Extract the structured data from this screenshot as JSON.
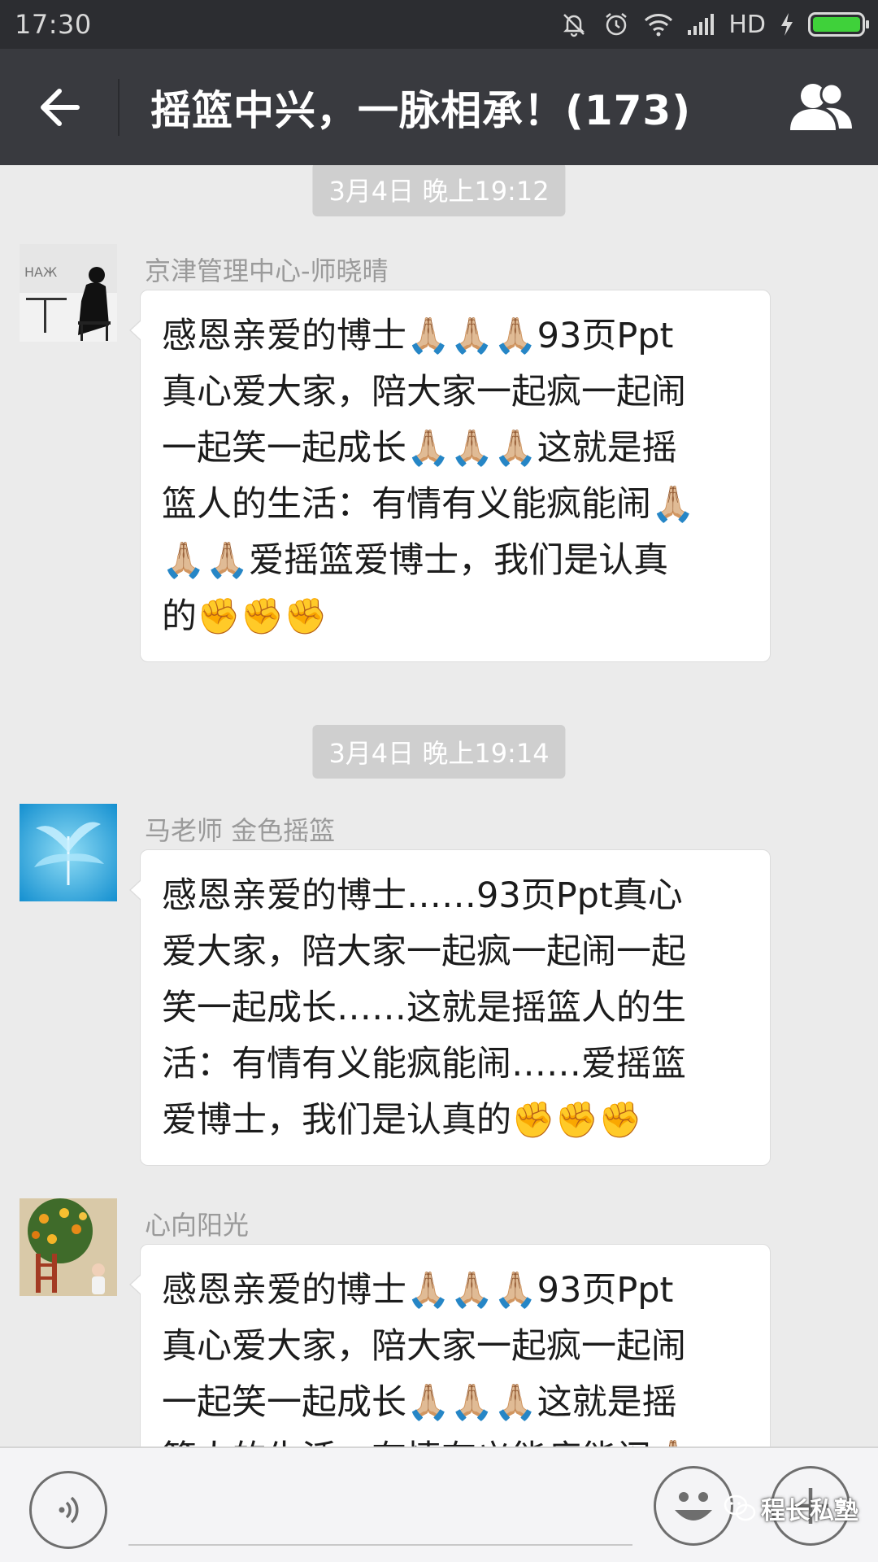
{
  "status_bar": {
    "time": "17:30",
    "network": "HD",
    "icons": [
      "mute-icon",
      "alarm-icon",
      "wifi-icon",
      "signal-icon",
      "charging-icon",
      "battery-icon"
    ],
    "battery_level": 1.0
  },
  "header": {
    "title": "摇篮中兴，一脉相承！(173)",
    "back_icon": "back-arrow-icon",
    "members_icon": "group-members-icon"
  },
  "messages": [
    {
      "timestamp": "3月4日 晚上19:12",
      "sender": "京津管理中心-师晓晴",
      "lines": [
        "感恩亲爱的博士🙏🏼🙏🏼🙏🏼93页Ppt",
        "真心爱大家，陪大家一起疯一起闹",
        "一起笑一起成长🙏🏼🙏🏼🙏🏼这就是摇",
        "篮人的生活：有情有义能疯能闹🙏🏼",
        "🙏🏼🙏🏼爱摇篮爱博士，我们是认真",
        "的✊✊✊"
      ]
    },
    {
      "timestamp": "3月4日 晚上19:14",
      "sender": "马老师  金色摇篮",
      "lines": [
        "感恩亲爱的博士……93页Ppt真心",
        "爱大家，陪大家一起疯一起闹一起",
        "笑一起成长……这就是摇篮人的生",
        "活：有情有义能疯能闹……爱摇篮",
        "爱博士，我们是认真的✊✊✊"
      ]
    },
    {
      "timestamp": "",
      "sender": "心向阳光",
      "lines": [
        "感恩亲爱的博士🙏🏼🙏🏼🙏🏼93页Ppt",
        "真心爱大家，陪大家一起疯一起闹",
        "一起笑一起成长🙏🏼🙏🏼🙏🏼这就是摇",
        "篮人的生活：有情有义能疯能闹🙏🏼"
      ]
    }
  ],
  "input_bar": {
    "placeholder": "",
    "voice_icon": "voice-icon",
    "emoji_icon": "emoji-icon",
    "plus_icon": "plus-icon"
  },
  "watermark": {
    "text": "程长私塾",
    "icon": "wechat-logo-icon"
  },
  "colors": {
    "status_bar_bg": "#2c2d31",
    "title_bar_bg": "#393a3f",
    "chat_bg": "#ebebeb",
    "bubble_bg": "#ffffff",
    "timestamp_bg": "#cfcfcf",
    "battery_fill": "#3fd13a"
  }
}
